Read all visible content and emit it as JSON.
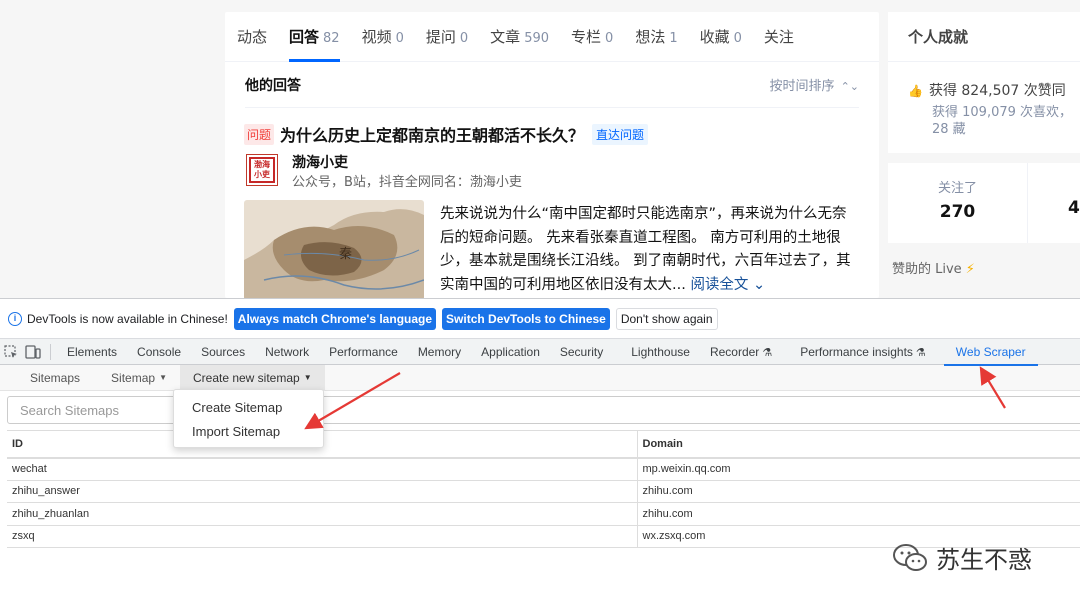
{
  "zhihu": {
    "tabs": [
      {
        "label": "动态",
        "count": ""
      },
      {
        "label": "回答",
        "count": "82"
      },
      {
        "label": "视频",
        "count": "0"
      },
      {
        "label": "提问",
        "count": "0"
      },
      {
        "label": "文章",
        "count": "590"
      },
      {
        "label": "专栏",
        "count": "0"
      },
      {
        "label": "想法",
        "count": "1"
      },
      {
        "label": "收藏",
        "count": "0"
      },
      {
        "label": "关注",
        "count": ""
      }
    ],
    "section_title": "他的回答",
    "sort_label": "按时间排序",
    "question": {
      "tag": "问题",
      "title": "为什么历史上定都南京的王朝都活不长久？",
      "link": "直达问题"
    },
    "author": {
      "avatar_text": "渤海小吏",
      "name": "渤海小吏",
      "bio": "公众号，B站，抖音全网同名：渤海小吏"
    },
    "excerpt": "先来说说为什么“南中国定都时只能选南京”，再来说为什么无奈后的短命问题。 先来看张秦直道工程图。 南方可利用的土地很少，基本就是围绕长江沿线。 到了南朝时代，六百年过去了，其实南中国的可利用地区依旧没有太大...",
    "read_more": "阅读全文",
    "map_label": "秦",
    "sidebar": {
      "achievement_title": "个人成就",
      "likes": "获得 824,507 次赞同",
      "likes_sub": "获得 109,079 次喜欢，28 藏",
      "following_label": "关注了",
      "following_value": "270",
      "followers_value": "4",
      "live_label": "赞助的 Live"
    }
  },
  "devtools": {
    "info_text": "DevTools is now available in Chinese!",
    "btn_match": "Always match Chrome's language",
    "btn_switch": "Switch DevTools to Chinese",
    "btn_dismiss": "Don't show again",
    "tabs": [
      "Elements",
      "Console",
      "Sources",
      "Network",
      "Performance",
      "Memory",
      "Application",
      "Security",
      "Lighthouse",
      "Recorder",
      "Performance insights",
      "Web Scraper"
    ],
    "active_tab": "Web Scraper"
  },
  "scraper": {
    "nav": [
      "Sitemaps",
      "Sitemap",
      "Create new sitemap"
    ],
    "search_placeholder": "Search Sitemaps",
    "dropdown": [
      "Create Sitemap",
      "Import Sitemap"
    ],
    "columns": [
      "ID",
      "Domain"
    ],
    "rows": [
      [
        "wechat",
        "mp.weixin.qq.com"
      ],
      [
        "zhihu_answer",
        "zhihu.com"
      ],
      [
        "zhihu_zhuanlan",
        "zhihu.com"
      ],
      [
        "zsxq",
        "wx.zsxq.com"
      ]
    ]
  },
  "watermark": "苏生不惑",
  "colors": {
    "zhihu_blue": "#0066ff",
    "devtools_blue": "#1a73e8",
    "annotation_red": "#e53935"
  }
}
